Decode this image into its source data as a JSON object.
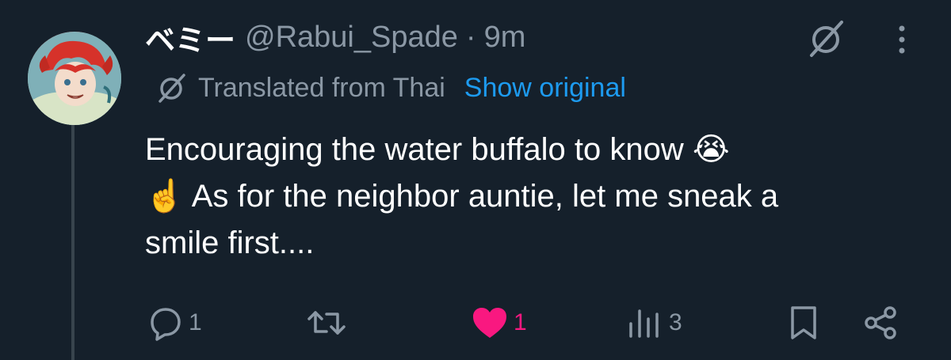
{
  "tweet": {
    "author": {
      "display_name": "ベミー",
      "handle": "@Rabui_Spade",
      "separator": "·",
      "time": "9m"
    },
    "translation": {
      "label": "Translated from Thai",
      "show_original": "Show original"
    },
    "text_lines": [
      "Encouraging the water buffalo to know 😭",
      "☝️ As for the neighbor auntie, let me sneak a",
      "smile first...."
    ],
    "actions": {
      "reply_count": "1",
      "retweet_count": "",
      "like_count": "1",
      "views_count": "3"
    }
  },
  "icons": {
    "header": [
      "grok-icon",
      "more-icon"
    ],
    "translate": "translate-icon",
    "actions": [
      "reply-icon",
      "retweet-icon",
      "like-icon",
      "views-icon",
      "bookmark-icon",
      "share-icon"
    ]
  },
  "colors": {
    "background": "#15202b",
    "secondary_text": "#8b98a5",
    "link": "#1d9bf0",
    "like": "#f91880"
  }
}
